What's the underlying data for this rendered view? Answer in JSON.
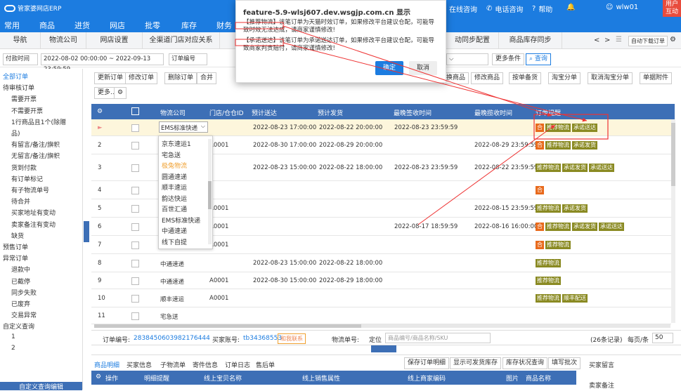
{
  "app": {
    "logo": "管家婆网店ERP",
    "nav": [
      "在线咨询",
      "电话咨询",
      "帮助"
    ],
    "user": "wlw01",
    "user_btn": "用户互动"
  },
  "menu": [
    "常用",
    "商品",
    "进货",
    "网店",
    "批零",
    "库存",
    "财务"
  ],
  "tabs": [
    "导航",
    "物流公司",
    "网店设置",
    "全渠道门店对应关系",
    "",
    "动同步配置",
    "商品库存同步"
  ],
  "tab_tools": {
    "prev": "<",
    "next": ">",
    "auto": "自动下载订单"
  },
  "filter": {
    "time_type": "付款时间",
    "date_range": "2022-08-02 00:00:00 ~ 2022-09-13 23:59:59",
    "order_no": "订单编号",
    "more": "更多条件",
    "search": "查询"
  },
  "sidebar": [
    "全部订单",
    "待审核订单",
    "需要开票",
    "不需要开票",
    "1行商品且1个(除赠",
    "品)",
    "有留言/备注/旗帜",
    "无留言/备注/旗帜",
    "货到付款",
    "有订单标记",
    "有子物流单号",
    "待合并",
    "买家地址有变动",
    "卖家备注有变动",
    "缺货",
    "预售订单",
    "异常订单",
    "退款中",
    "已截停",
    "同步失败",
    "已废弃",
    "交易异常",
    "自定义查询",
    "1",
    "2",
    "自定义查询编辑"
  ],
  "toolbar": {
    "row1": [
      "更新订单",
      "修改订单",
      "删除订单",
      "合并",
      "换商品",
      "修改商品",
      "按单备货",
      "淘宝分单",
      "取消淘宝分单",
      "单据附件"
    ],
    "row2": [
      "更多..",
      "⚙"
    ]
  },
  "table": {
    "headers": [
      "⚙",
      "",
      "物流公司",
      "门店/仓仓ID",
      "预计送达",
      "预计发货",
      "最晚签收时间",
      "最晚揽收时间",
      "订单提醒"
    ],
    "rows": [
      {
        "n": "►",
        "logistics": "EMS标准快递",
        "store": "",
        "arrive": "2022-08-23 17:00:00",
        "ship": "2022-08-22 20:00:00",
        "sign": "2022-08-23 23:59:59",
        "collect": "",
        "tags": [
          "合",
          "推荐物流",
          "承诺送达"
        ]
      },
      {
        "n": "2",
        "logistics": "",
        "store": "A0001",
        "arrive": "2022-08-30 17:00:00",
        "ship": "2022-08-29 20:00:00",
        "sign": "",
        "collect": "2022-08-29 23:59:59",
        "tags": [
          "合",
          "推荐物流",
          "承诺发货"
        ]
      },
      {
        "n": "3",
        "logistics": "",
        "store": "",
        "arrive": "2022-08-23 15:00:00",
        "ship": "2022-08-22 18:00:00",
        "sign": "2022-08-23 23:59:59",
        "collect": "2022-08-22 23:59:59",
        "tags": [
          "推荐物流",
          "承诺发货",
          "承诺送达"
        ]
      },
      {
        "n": "4",
        "logistics": "",
        "store": "",
        "arrive": "",
        "ship": "",
        "sign": "",
        "collect": "",
        "tags": [
          "合"
        ]
      },
      {
        "n": "5",
        "logistics": "",
        "store": "A0001",
        "arrive": "",
        "ship": "",
        "sign": "",
        "collect": "2022-08-15 23:59:59",
        "tags": [
          "推荐物流",
          "承诺发货"
        ]
      },
      {
        "n": "6",
        "logistics": "",
        "store": "A0001",
        "arrive": "",
        "ship": "",
        "sign": "2022-08-17 18:59:59",
        "collect": "2022-08-16 16:00:00",
        "tags": [
          "合",
          "推荐物流",
          "承诺发货",
          "承诺送达"
        ]
      },
      {
        "n": "7",
        "logistics": "",
        "store": "A0001",
        "arrive": "",
        "ship": "",
        "sign": "",
        "collect": "",
        "tags": [
          "合",
          "推荐物流"
        ]
      },
      {
        "n": "8",
        "logistics": "中通速递",
        "store": "",
        "arrive": "2022-08-23 15:00:00",
        "ship": "2022-08-22 18:00:00",
        "sign": "",
        "collect": "",
        "tags": [
          "推荐物流"
        ]
      },
      {
        "n": "9",
        "logistics": "中通速递",
        "store": "A0001",
        "arrive": "2022-08-30 15:00:00",
        "ship": "2022-08-29 18:00:00",
        "sign": "",
        "collect": "",
        "tags": [
          "推荐物流"
        ]
      },
      {
        "n": "10",
        "logistics": "顺丰速运",
        "store": "A0001",
        "arrive": "",
        "ship": "",
        "sign": "",
        "collect": "",
        "tags": [
          "推荐物流",
          "顺丰配送"
        ]
      },
      {
        "n": "11",
        "logistics": "宅急送",
        "store": "",
        "arrive": "",
        "ship": "",
        "sign": "",
        "collect": "",
        "tags": []
      }
    ]
  },
  "dropdown": [
    "京东速运1",
    "宅急送",
    "极兔物流",
    "圆通速递",
    "顺丰速运",
    "韵达快运",
    "百世汇通",
    "EMS标准快递",
    "中通速递",
    "线下自提"
  ],
  "modal": {
    "title": "feature-5.9-wlsj607.dev.wsgjp.com.cn 显示",
    "line1": "【推荐物流】该笔订单为天猫时效订单，如果修改平台建议仓配，可能导致时效无法达成，请商家谨慎修改!",
    "line2": "【承诺送达】该笔订单为承诺送达订单，如果修改平台建议仓配，可能导致商家判责赔付，请商家谨慎修改!",
    "ok": "确定",
    "cancel": "取消"
  },
  "status": {
    "order_label": "订单编号:",
    "order_val": "2838450603982176444",
    "buyer_label": "买家账号:",
    "buyer_val": "tb34368553",
    "contact": "和我联系",
    "logistics_label": "物流单号:",
    "locate": "定位",
    "locate_ph": "商品编号/商品名称/SKU",
    "records": "(26条记录)",
    "per_page_label": "每页/条",
    "per_page": "50"
  },
  "bottom": {
    "tabs": [
      "商品明细",
      "买家信息",
      "子物流单",
      "寄件信息",
      "订单日志",
      "售后单"
    ],
    "buttons": [
      "保存订单明细",
      "显示可发货库存",
      "库存状况查询",
      "填写批次"
    ],
    "cols": [
      "⚙",
      "操作",
      "明细提醒",
      "线上宝贝名称",
      "线上销售属性",
      "线上商家编码",
      "图片",
      "商品名称"
    ],
    "right1": "买家留言",
    "right2": "卖家备注"
  }
}
